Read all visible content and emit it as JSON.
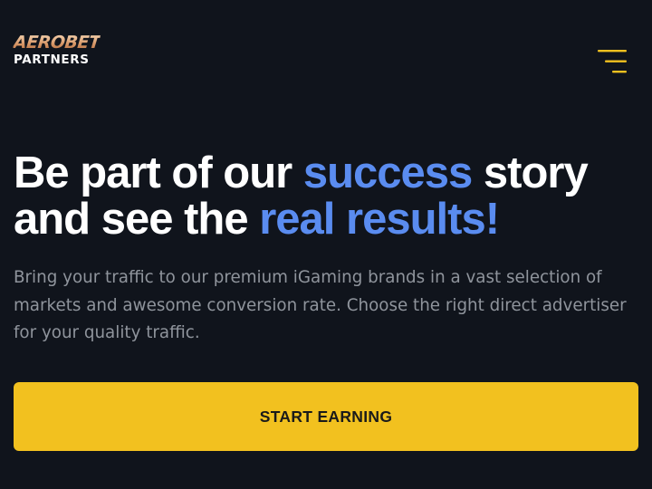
{
  "header": {
    "logo": {
      "brand_top": "AEROBET",
      "brand_bottom": "PARTNERS"
    },
    "menu_icon": "hamburger-menu-icon"
  },
  "hero": {
    "title": {
      "part1": "Be part of our ",
      "accent1": "success",
      "part2": " story and see the ",
      "accent2": "real results!"
    },
    "description": "Bring your traffic to our premium iGaming brands in a vast selection of markets and awesome conversion rate. Choose the right direct advertiser for your quality traffic.",
    "cta_label": "START EARNING"
  },
  "colors": {
    "background": "#10141c",
    "accent": "#5a8cf0",
    "cta": "#f2c11f",
    "menu_icon": "#f2c11f",
    "logo_gradient": "#d79767"
  }
}
